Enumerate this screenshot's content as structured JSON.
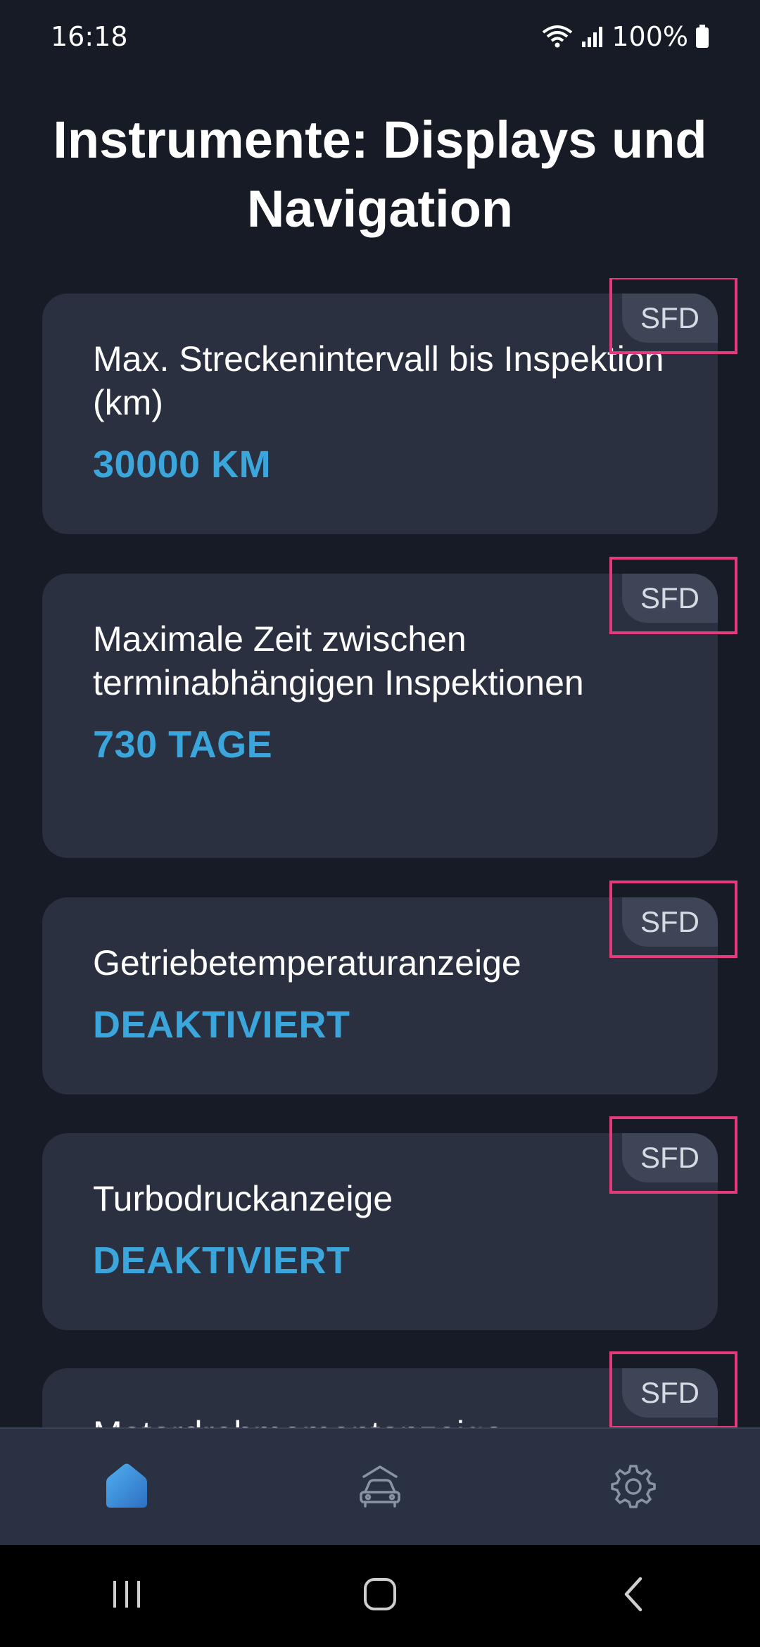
{
  "status_bar": {
    "time": "16:18",
    "battery": "100%",
    "icons": [
      "wifi-icon",
      "signal-icon",
      "battery-icon"
    ]
  },
  "page": {
    "title": "Instrumente: Displays und Navigation"
  },
  "cards": [
    {
      "label": "Max. Streckenintervall bis Inspektion (km)",
      "value": "30000 KM",
      "badge": "SFD"
    },
    {
      "label": "Maximale Zeit zwischen terminabhängigen Inspektionen",
      "value": "730 TAGE",
      "badge": "SFD"
    },
    {
      "label": "Getriebetemperaturanzeige",
      "value": "DEAKTIVIERT",
      "badge": "SFD"
    },
    {
      "label": "Turbodruckanzeige",
      "value": "DEAKTIVIERT",
      "badge": "SFD"
    },
    {
      "label": "Motordrehmomentanzeige",
      "value": "",
      "badge": "SFD"
    }
  ],
  "bottom_nav": {
    "items": [
      {
        "icon": "home-icon",
        "active": true
      },
      {
        "icon": "car-icon",
        "active": false
      },
      {
        "icon": "gear-icon",
        "active": false
      }
    ]
  },
  "system_nav": {
    "icons": [
      "recent-apps-icon",
      "home-circle-icon",
      "back-icon"
    ]
  },
  "colors": {
    "background": "#161b26",
    "card": "#2a3040",
    "accent": "#3aa6dc",
    "badge": "#3d4556",
    "highlight": "#e63b7a"
  }
}
